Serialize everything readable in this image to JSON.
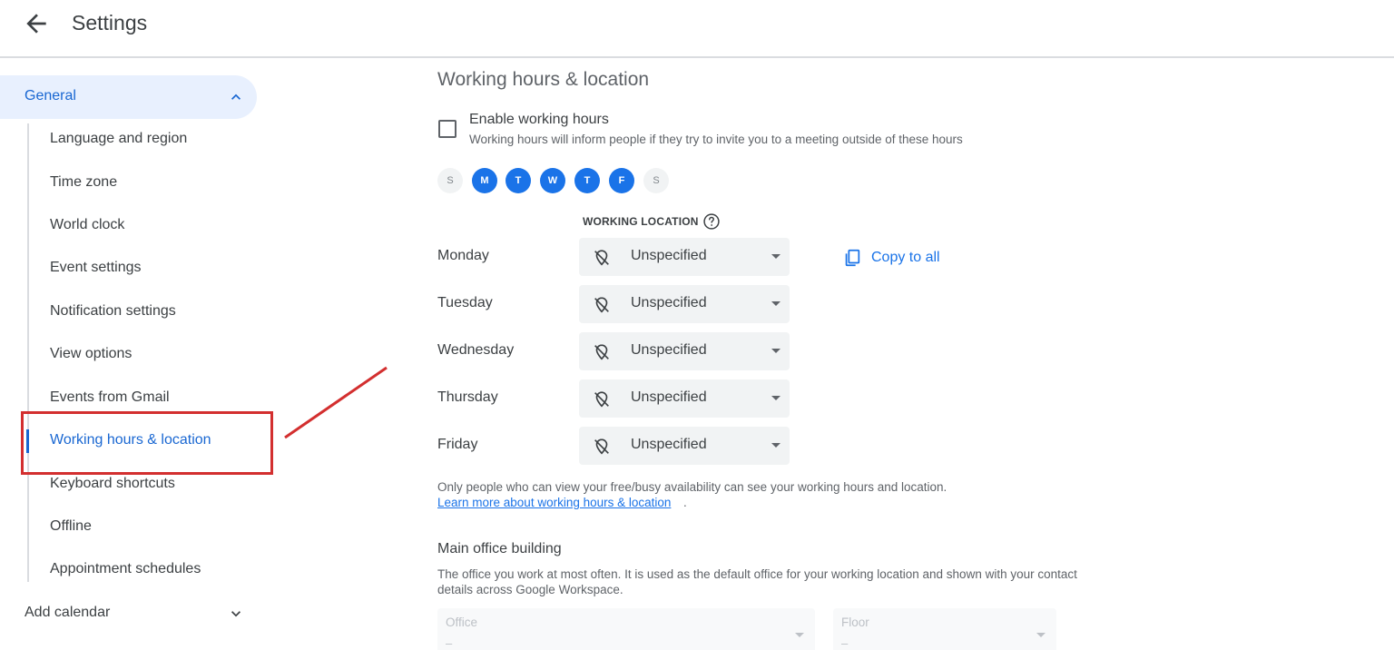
{
  "header": {
    "title": "Settings"
  },
  "sidebar": {
    "general_label": "General",
    "items": [
      {
        "label": "Language and region"
      },
      {
        "label": "Time zone"
      },
      {
        "label": "World clock"
      },
      {
        "label": "Event settings"
      },
      {
        "label": "Notification settings"
      },
      {
        "label": "View options"
      },
      {
        "label": "Events from Gmail"
      },
      {
        "label": "Working hours & location",
        "active": true
      },
      {
        "label": "Keyboard shortcuts"
      },
      {
        "label": "Offline"
      },
      {
        "label": "Appointment schedules"
      }
    ],
    "add_calendar_label": "Add calendar"
  },
  "main": {
    "section_title": "Working hours & location",
    "enable_label": "Enable working hours",
    "enable_description": "Working hours will inform people if they try to invite you to a meeting outside of these hours",
    "enable_checked": false,
    "days": [
      {
        "letter": "S",
        "selected": false
      },
      {
        "letter": "M",
        "selected": true
      },
      {
        "letter": "T",
        "selected": true
      },
      {
        "letter": "W",
        "selected": true
      },
      {
        "letter": "T",
        "selected": true
      },
      {
        "letter": "F",
        "selected": true
      },
      {
        "letter": "S",
        "selected": false
      }
    ],
    "working_location_header": "WORKING LOCATION",
    "rows": [
      {
        "day": "Monday",
        "location": "Unspecified"
      },
      {
        "day": "Tuesday",
        "location": "Unspecified"
      },
      {
        "day": "Wednesday",
        "location": "Unspecified"
      },
      {
        "day": "Thursday",
        "location": "Unspecified"
      },
      {
        "day": "Friday",
        "location": "Unspecified"
      }
    ],
    "copy_to_all_label": "Copy to all",
    "note_text": "Only people who can view your free/busy availability can see your working hours and location.",
    "note_link": "Learn more about working hours & location",
    "note_suffix": ".",
    "office_title": "Main office building",
    "office_description": "The office you work at most often. It is used as the default office for your working location and shown with your contact details across Google Workspace.",
    "office_field": {
      "label": "Office",
      "value": "–"
    },
    "floor_field": {
      "label": "Floor",
      "value": "–"
    }
  },
  "colors": {
    "accent": "#1a73e8",
    "active_text": "#1967d2",
    "nav_selected_bg": "#e8f0fe",
    "annotation_red": "#d32f2f"
  },
  "icons": {
    "back": "arrow-left-icon",
    "expand": "chevron-up-icon",
    "collapse": "chevron-down-icon",
    "help": "question-mark-circle-icon",
    "location": "location-off-icon",
    "copy": "copy-icon"
  }
}
